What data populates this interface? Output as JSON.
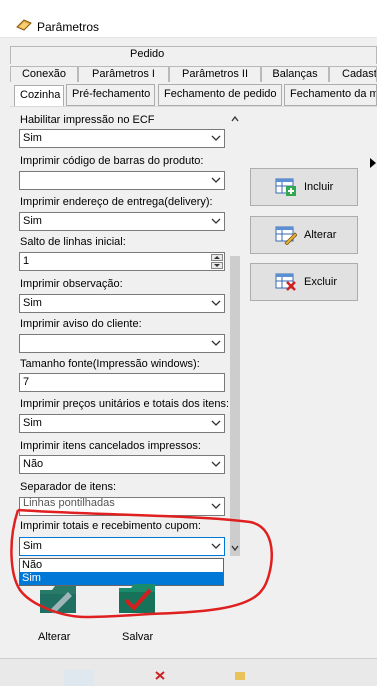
{
  "window": {
    "title": "Parâmetros"
  },
  "tabs": {
    "row1": [
      "Pedido"
    ],
    "row2": [
      "Conexão",
      "Parâmetros I",
      "Parâmetros II",
      "Balanças",
      "Cadast"
    ],
    "row3": [
      "Cozinha",
      "Pré-fechamento",
      "Fechamento de pedido",
      "Fechamento da me"
    ]
  },
  "fields": [
    {
      "label": "Habilitar impressão no ECF",
      "value": "Sim",
      "kind": "combo"
    },
    {
      "label": "Imprimir código de barras do produto:",
      "value": "",
      "kind": "combo"
    },
    {
      "label": "Imprimir endereço de entrega(delivery):",
      "value": "Sim",
      "kind": "combo"
    },
    {
      "label": "Salto de linhas inicial:",
      "value": "1",
      "kind": "spin"
    },
    {
      "label": "Imprimir observação:",
      "value": "Sim",
      "kind": "combo"
    },
    {
      "label": "Imprimir aviso do cliente:",
      "value": "",
      "kind": "combo"
    },
    {
      "label": "Tamanho fonte(Impressão windows):",
      "value": "7",
      "kind": "edit"
    },
    {
      "label": "Imprimir preços unitários e totais dos itens:",
      "value": "Sim",
      "kind": "combo"
    },
    {
      "label": "Imprimir itens cancelados impressos:",
      "value": "Não",
      "kind": "combo"
    },
    {
      "label": "Separador de itens:",
      "value": "Linhas pontilhadas",
      "kind": "combo"
    },
    {
      "label": "Imprimir totais e recebimento cupom:",
      "value": "Sim",
      "kind": "combo"
    }
  ],
  "dropdown": {
    "options": [
      "Não",
      "Sim"
    ],
    "selected": "Sim"
  },
  "side_buttons": {
    "incluir": "Incluir",
    "alterar": "Alterar",
    "excluir": "Excluir"
  },
  "bottom_buttons": {
    "alterar": "Alterar",
    "salvar": "Salvar"
  },
  "colors": {
    "selection": "#0078d7",
    "annotation": "#e02020",
    "accent_green": "#1a8c6c",
    "accent_red": "#d22020"
  }
}
